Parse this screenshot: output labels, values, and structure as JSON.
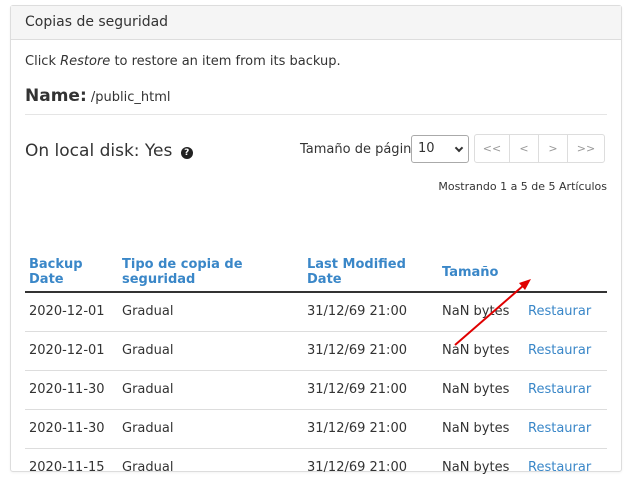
{
  "panel": {
    "title": "Copias de seguridad"
  },
  "instructions": {
    "prefix": "Click ",
    "emphasis": "Restore",
    "suffix": " to restore an item from its backup."
  },
  "name": {
    "label": "Name:",
    "value": " /public_html"
  },
  "local_disk": {
    "text": "On local disk: Yes",
    "help_icon": "question-circle-icon"
  },
  "pagination": {
    "page_size_label": "Tamaño de página",
    "page_size_value": "10",
    "buttons": [
      "<<",
      "<",
      ">",
      ">>"
    ],
    "showing_text": "Mostrando 1 a 5 de 5 Artículos"
  },
  "table": {
    "headers": [
      "Backup Date",
      "Tipo de copia de seguridad",
      "Last Modified Date",
      "Tamaño",
      ""
    ],
    "rows": [
      {
        "date": "2020-12-01",
        "type": "Gradual",
        "modified": "31/12/69 21:00",
        "size": "NaN bytes",
        "action": "Restaurar"
      },
      {
        "date": "2020-12-01",
        "type": "Gradual",
        "modified": "31/12/69 21:00",
        "size": "NaN bytes",
        "action": "Restaurar"
      },
      {
        "date": "2020-11-30",
        "type": "Gradual",
        "modified": "31/12/69 21:00",
        "size": "NaN bytes",
        "action": "Restaurar"
      },
      {
        "date": "2020-11-30",
        "type": "Gradual",
        "modified": "31/12/69 21:00",
        "size": "NaN bytes",
        "action": "Restaurar"
      },
      {
        "date": "2020-11-15",
        "type": "Gradual",
        "modified": "31/12/69 21:00",
        "size": "NaN bytes",
        "action": "Restaurar"
      }
    ]
  },
  "colors": {
    "link": "#3a87c8",
    "annotation_arrow": "#e00000"
  }
}
